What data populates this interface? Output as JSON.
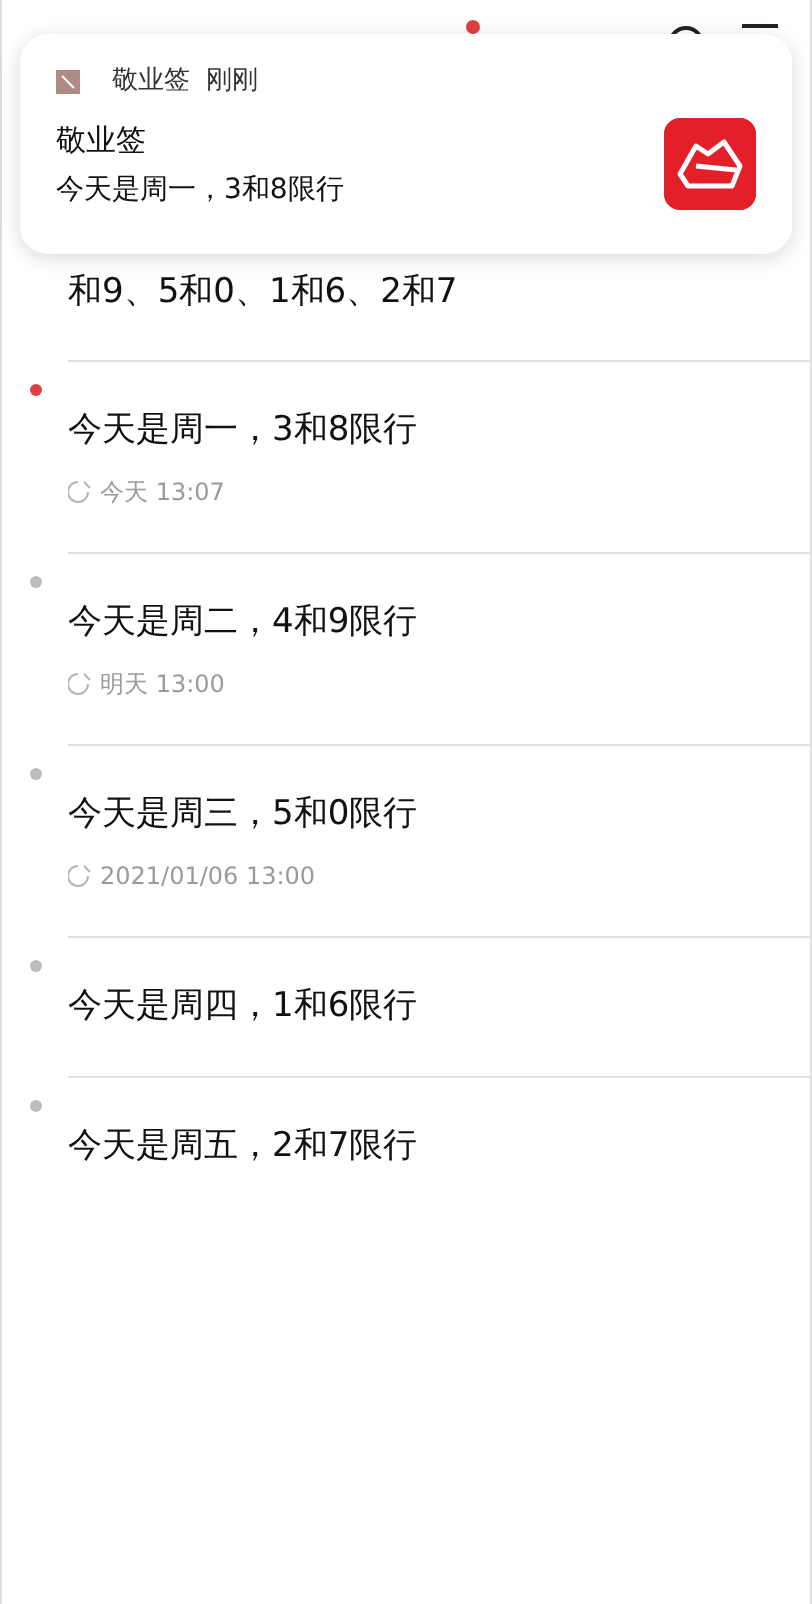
{
  "header": {
    "unread_dot": true
  },
  "notification": {
    "app": "敬业签",
    "time": "刚刚",
    "title": "敬业签",
    "body": "今天是周一，3和8限行"
  },
  "partial_item": {
    "text": "和9、5和0、1和6、2和7"
  },
  "items": [
    {
      "text": "今天是周一，3和8限行",
      "unread": true,
      "reminder": "今天 13:07"
    },
    {
      "text": "今天是周二，4和9限行",
      "unread": false,
      "reminder": "明天 13:00"
    },
    {
      "text": "今天是周三，5和0限行",
      "unread": false,
      "reminder": "2021/01/06 13:00"
    },
    {
      "text": "今天是周四，1和6限行",
      "unread": false
    },
    {
      "text": "今天是周五，2和7限行",
      "unread": false
    }
  ]
}
